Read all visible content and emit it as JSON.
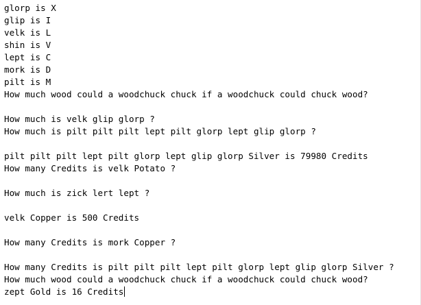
{
  "editor": {
    "lines": [
      "glorp is X",
      "glip is I",
      "velk is L",
      "shin is V",
      "lept is C",
      "mork is D",
      "pilt is M",
      "How much wood could a woodchuck chuck if a woodchuck could chuck wood?",
      "",
      "How much is velk glip glorp ?",
      "How much is pilt pilt pilt lept pilt glorp lept glip glorp ?",
      "",
      "pilt pilt pilt lept pilt glorp lept glip glorp Silver is 79980 Credits",
      "How many Credits is velk Potato ?",
      "",
      "How much is zick lert lept ?",
      "",
      "velk Copper is 500 Credits",
      "",
      "How many Credits is mork Copper ?",
      "",
      "How many Credits is pilt pilt pilt lept pilt glorp lept glip glorp Silver ?",
      "How much wood could a woodchuck chuck if a woodchuck could chuck wood?",
      "zept Gold is 16 Credits"
    ]
  }
}
